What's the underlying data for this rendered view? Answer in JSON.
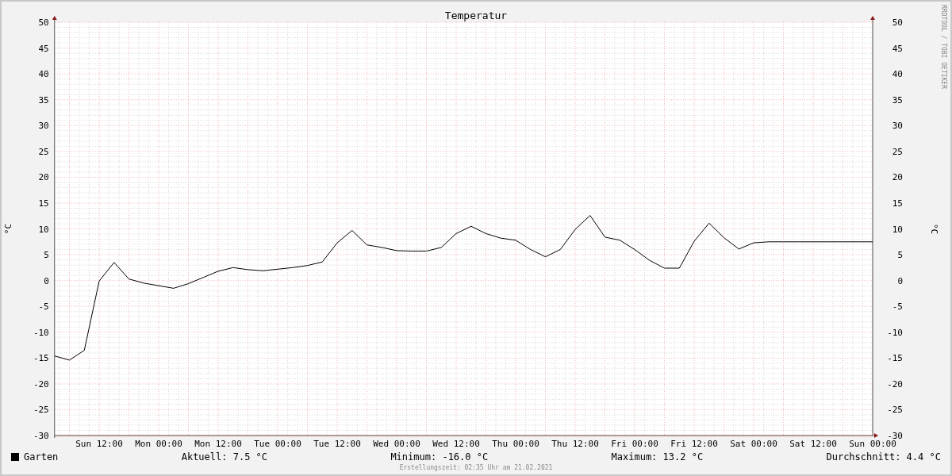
{
  "chart": {
    "chart_data": {
      "type": "line",
      "title": "Temperatur",
      "ylabel": "°C",
      "categories": [
        null,
        null,
        null,
        "Sun 12:00",
        null,
        null,
        null,
        "Mon 00:00",
        null,
        null,
        null,
        "Mon 12:00",
        null,
        null,
        null,
        "Tue 00:00",
        null,
        null,
        null,
        "Tue 12:00",
        null,
        null,
        null,
        "Wed 00:00",
        null,
        null,
        null,
        "Wed 12:00",
        null,
        null,
        null,
        "Thu 00:00",
        null,
        null,
        null,
        "Thu 12:00",
        null,
        null,
        null,
        "Fri 00:00",
        null,
        null,
        null,
        "Fri 12:00",
        null,
        null,
        null,
        "Sat 00:00",
        null,
        null,
        null,
        "Sat 12:00",
        null,
        null,
        null,
        "Sun 00:00"
      ],
      "series": [
        {
          "name": "Garten",
          "color": "#000000",
          "values": [
            -14.6,
            -15.4,
            -13.5,
            -0.1,
            3.5,
            0.3,
            -0.5,
            -1.0,
            -1.5,
            -0.6,
            0.6,
            1.8,
            2.5,
            2.1,
            1.9,
            2.2,
            2.5,
            2.9,
            3.6,
            7.3,
            9.7,
            6.9,
            6.4,
            5.8,
            5.7,
            5.7,
            6.4,
            9.1,
            10.5,
            9.1,
            8.2,
            7.8,
            6.0,
            4.6,
            6.0,
            9.9,
            12.6,
            8.4,
            7.8,
            6.0,
            3.9,
            2.4,
            2.4,
            7.6,
            11.1,
            8.3,
            6.1,
            7.3,
            7.5,
            7.5,
            7.5,
            7.5,
            7.5,
            7.5,
            7.5,
            7.5
          ]
        }
      ],
      "ylim": [
        -30,
        50
      ],
      "grid": true,
      "yticks": [
        -30,
        -25,
        -20,
        -15,
        -10,
        -5,
        0,
        5,
        10,
        15,
        20,
        25,
        30,
        35,
        40,
        45,
        50
      ]
    },
    "right_yticks": [
      "50",
      "45",
      "40",
      "35",
      "30",
      "25",
      "20",
      "15",
      "10",
      "5",
      "0",
      "-5",
      "-10",
      "-15",
      "-20",
      "-25",
      "-30"
    ],
    "right_ylabel": "°C",
    "credit": "RRDTOOL / TOBI OETIKER"
  },
  "legend": {
    "stats": [
      "Aktuell: 7.5 °C",
      "Minimum: -16.0 °C",
      "Maximum: 13.2 °C",
      "Durchschnitt: 4.4 °C"
    ]
  },
  "footer": "Erstellungszeit: 02:35 Uhr am 21.02.2021"
}
